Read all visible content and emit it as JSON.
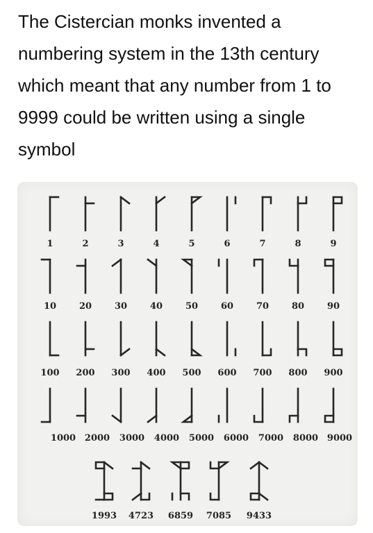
{
  "caption": "The Cistercian monks invented a numbering system in the 13th century which meant that any number from 1 to 9999 could be written using a single symbol",
  "rows": [
    {
      "labels": [
        "1",
        "2",
        "3",
        "4",
        "5",
        "6",
        "7",
        "8",
        "9"
      ]
    },
    {
      "labels": [
        "10",
        "20",
        "30",
        "40",
        "50",
        "60",
        "70",
        "80",
        "90"
      ]
    },
    {
      "labels": [
        "100",
        "200",
        "300",
        "400",
        "500",
        "600",
        "700",
        "800",
        "900"
      ]
    },
    {
      "labels": [
        "1000",
        "2000",
        "3000",
        "4000",
        "5000",
        "6000",
        "7000",
        "8000",
        "9000"
      ]
    }
  ],
  "examples": [
    "1993",
    "4723",
    "6859",
    "7085",
    "9433"
  ],
  "colors": {
    "ink": "#262626",
    "panel": "#f1f1ef",
    "text": "#111111"
  }
}
